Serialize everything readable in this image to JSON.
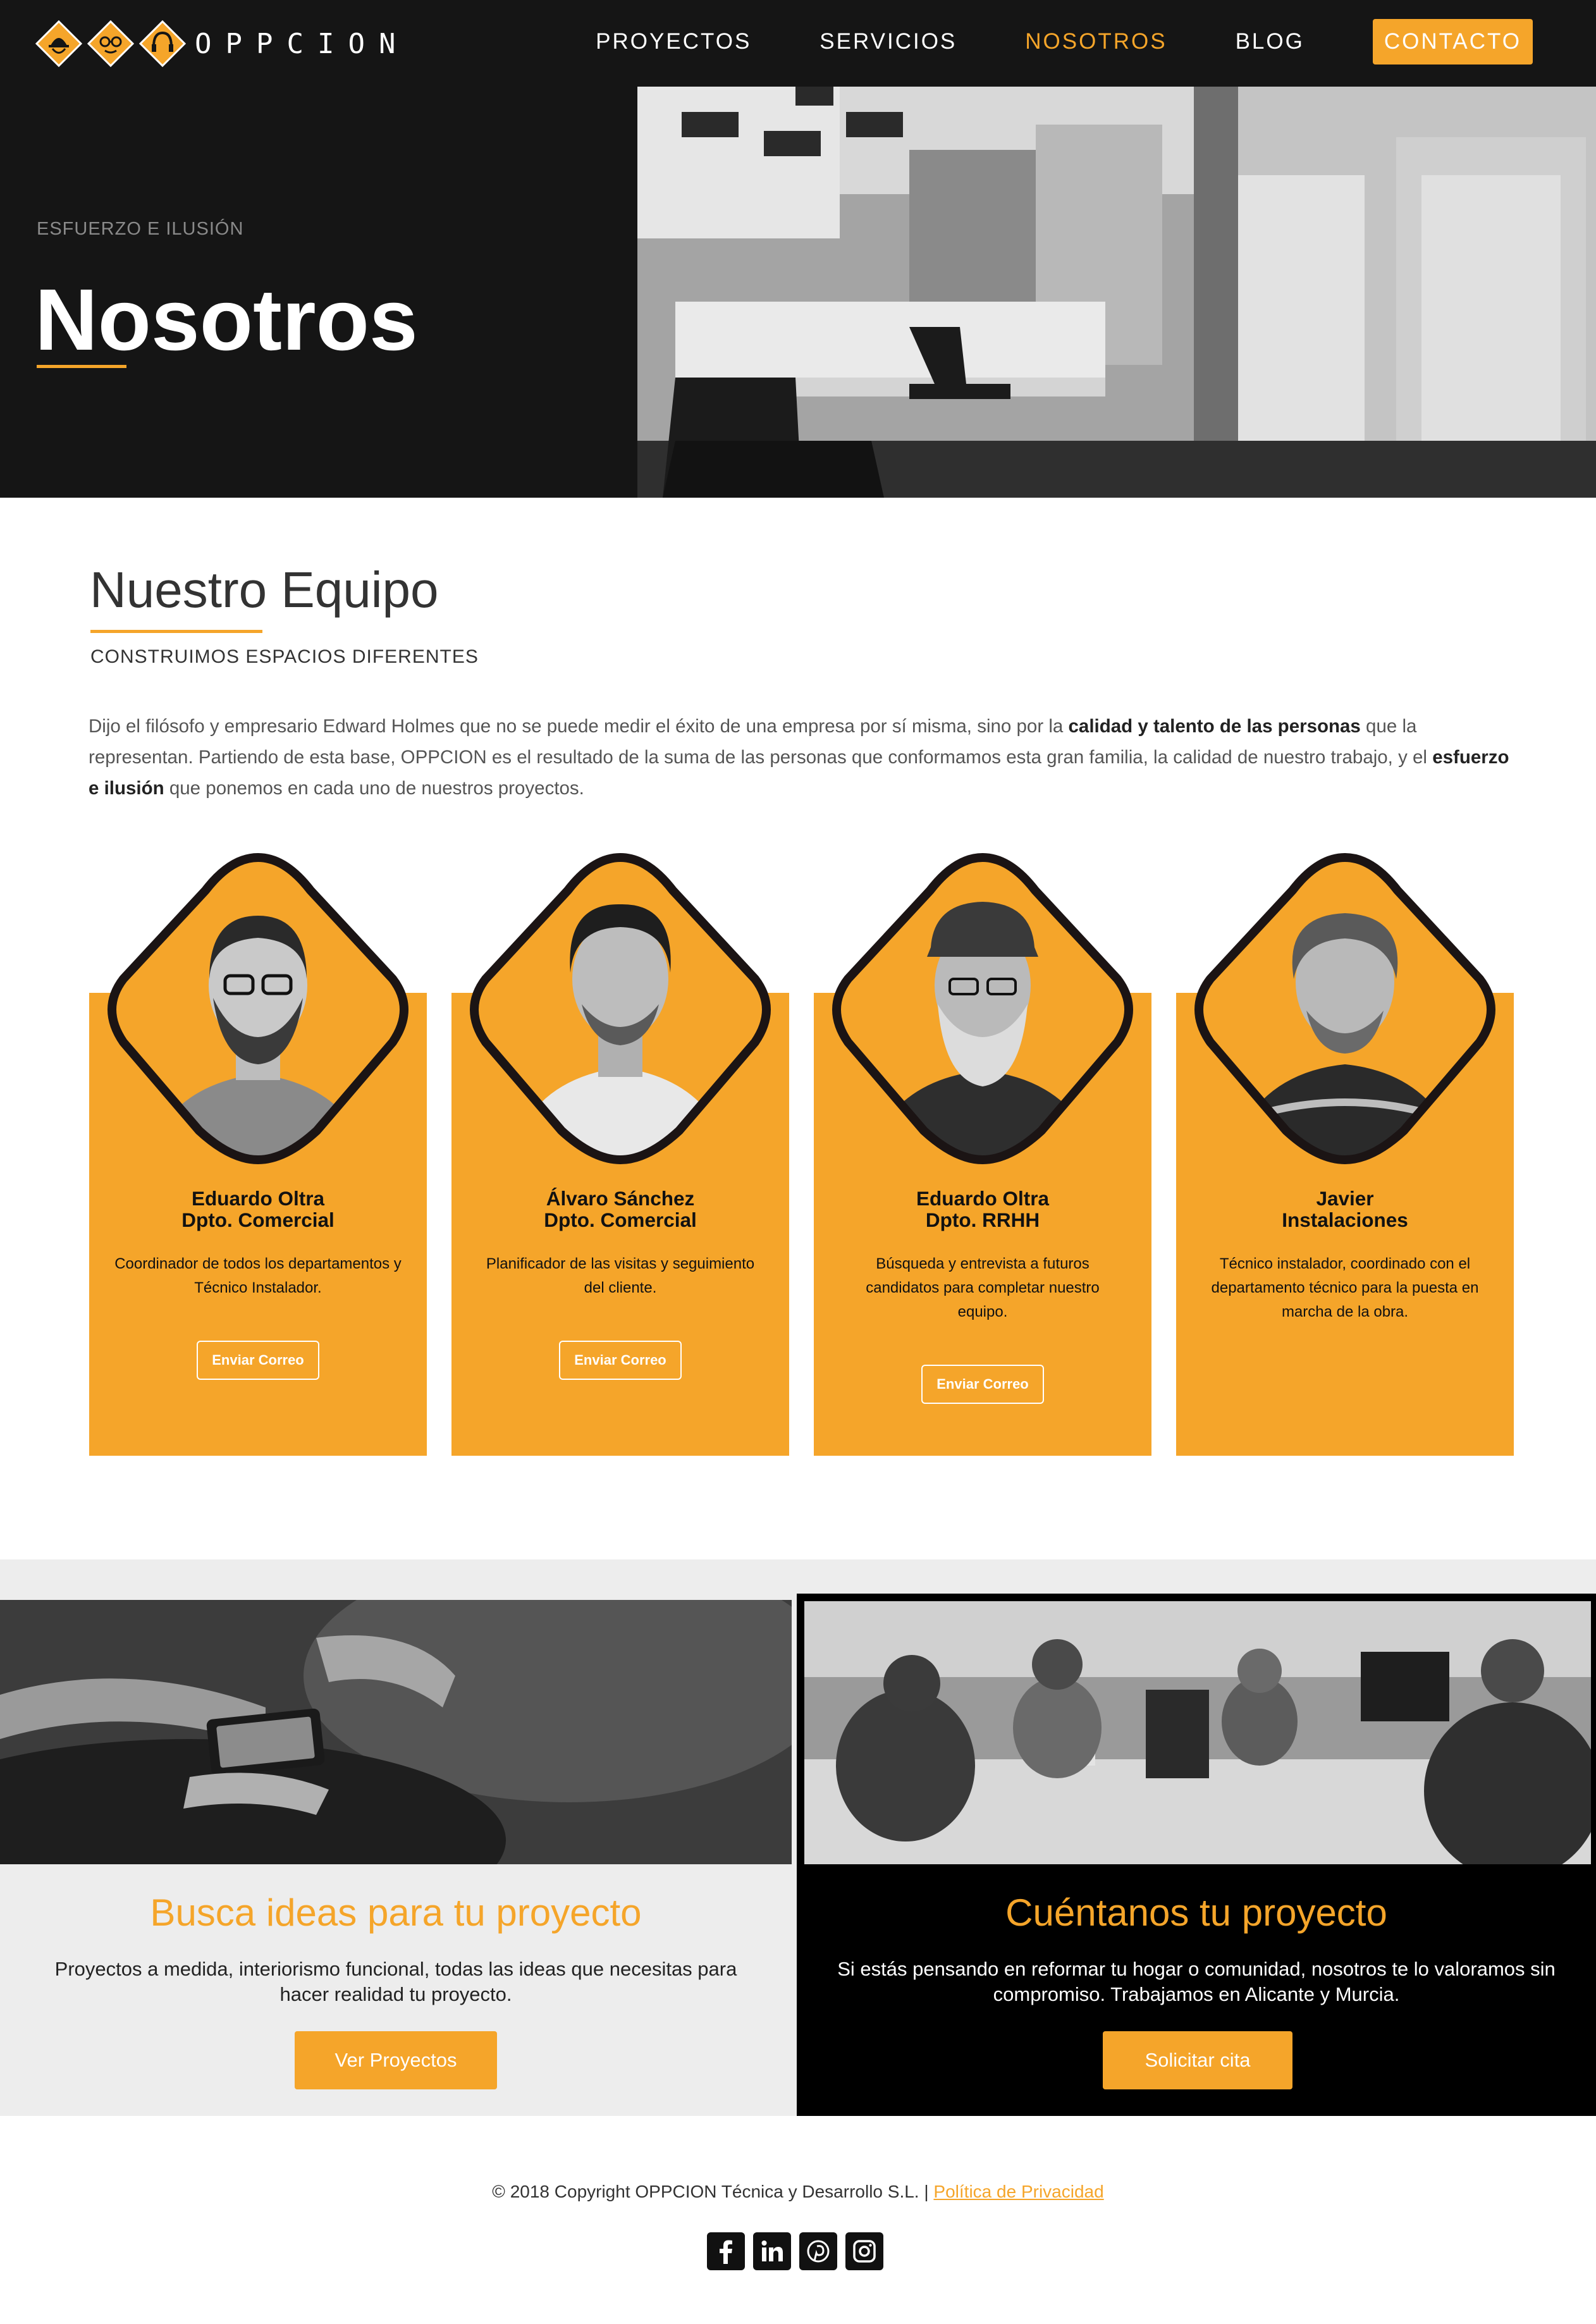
{
  "brand": {
    "name": "OPPCION",
    "accent": "#f5a52a",
    "dark": "#151515"
  },
  "nav": {
    "items": [
      {
        "label": "PROYECTOS"
      },
      {
        "label": "SERVICIOS"
      },
      {
        "label": "NOSOTROS",
        "active": true
      },
      {
        "label": "BLOG"
      }
    ],
    "contact_label": "CONTACTO"
  },
  "hero": {
    "kicker": "ESFUERZO E ILUSIÓN",
    "title": "Nosotros"
  },
  "team": {
    "title": "Nuestro Equipo",
    "subtitle": "CONSTRUIMOS ESPACIOS DIFERENTES",
    "intro": {
      "p1": "Dijo el filósofo y empresario Edward Holmes que no se puede medir el éxito de una empresa por sí misma, sino por la ",
      "b1": "calidad y talento de las personas",
      "p2": " que la representan. Partiendo de esta base, OPPCION es el resultado de la suma de las personas que conformamos esta gran familia, la calidad de nuestro trabajo, y el ",
      "b2": "esfuerzo e ilusión",
      "p3": " que ponemos en cada uno de nuestros proyectos."
    },
    "members": [
      {
        "name": "Eduardo Oltra",
        "role": "Dpto. Comercial",
        "description": "Coordinador de todos los departamentos y Técnico Instalador.",
        "button": "Enviar Correo"
      },
      {
        "name": "Álvaro Sánchez",
        "role": "Dpto. Comercial",
        "description": "Planificador de las visitas y  seguimiento del cliente.",
        "button": "Enviar Correo"
      },
      {
        "name": "Eduardo Oltra",
        "role": "Dpto. RRHH",
        "description": "Búsqueda y entrevista a futuros candidatos para completar nuestro equipo.",
        "button": "Enviar Correo"
      },
      {
        "name": "Javier",
        "role": "Instalaciones",
        "description": "Técnico instalador, coordinado con el departamento técnico para la puesta en marcha de la obra.",
        "button": ""
      }
    ]
  },
  "cta": {
    "left": {
      "heading": "Busca ideas para tu proyecto",
      "text": "Proyectos a medida, interiorismo funcional, todas las ideas que necesitas para hacer realidad tu proyecto.",
      "button": "Ver Proyectos"
    },
    "right": {
      "heading": "Cuéntanos tu proyecto",
      "text": "Si estás pensando en reformar tu hogar o comunidad, nosotros te lo valoramos sin compromiso. Trabajamos en Alicante y Murcia.",
      "button": "Solicitar cita"
    }
  },
  "footer": {
    "copyright": "© 2018 Copyright OPPCION Técnica y Desarrollo S.L. | ",
    "privacy": "Política de Privacidad",
    "socials": [
      "facebook-icon",
      "linkedin-icon",
      "pinterest-icon",
      "instagram-icon"
    ]
  }
}
